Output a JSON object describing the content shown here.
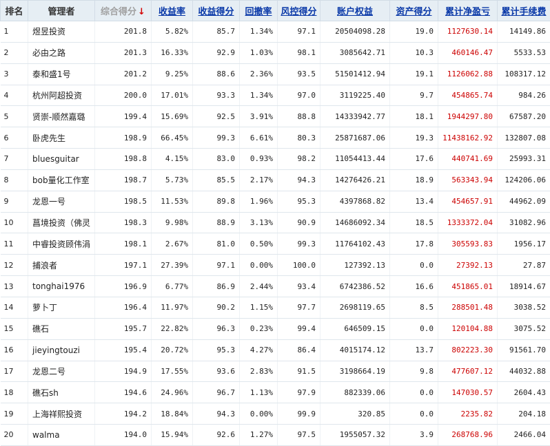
{
  "headers": {
    "rank": "排名",
    "manager": "管理者",
    "composite_score": "综合得分",
    "sort_arrow": "↓",
    "return_rate": "收益率",
    "return_score": "收益得分",
    "drawdown": "回撤率",
    "risk_score": "风控得分",
    "equity": "账户权益",
    "asset_score": "资产得分",
    "cum_pnl": "累计净盈亏",
    "cum_fee": "累计手续费"
  },
  "rows": [
    {
      "rank": "1",
      "name": "煜昱投资",
      "score": "201.8",
      "ret": "5.82%",
      "ret_score": "85.7",
      "dd": "1.34%",
      "risk": "97.1",
      "equity": "20504098.28",
      "asset": "19.0",
      "pnl": "1127630.14",
      "fee": "14149.86"
    },
    {
      "rank": "2",
      "name": "必由之路",
      "score": "201.3",
      "ret": "16.33%",
      "ret_score": "92.9",
      "dd": "1.03%",
      "risk": "98.1",
      "equity": "3085642.71",
      "asset": "10.3",
      "pnl": "460146.47",
      "fee": "5533.53"
    },
    {
      "rank": "3",
      "name": "泰和盛1号",
      "score": "201.2",
      "ret": "9.25%",
      "ret_score": "88.6",
      "dd": "2.36%",
      "risk": "93.5",
      "equity": "51501412.94",
      "asset": "19.1",
      "pnl": "1126062.88",
      "fee": "108317.12"
    },
    {
      "rank": "4",
      "name": "杭州阿超投资",
      "score": "200.0",
      "ret": "17.01%",
      "ret_score": "93.3",
      "dd": "1.34%",
      "risk": "97.0",
      "equity": "3119225.40",
      "asset": "9.7",
      "pnl": "454865.74",
      "fee": "984.26"
    },
    {
      "rank": "5",
      "name": "贤崇-顺然嘉璐",
      "score": "199.4",
      "ret": "15.69%",
      "ret_score": "92.5",
      "dd": "3.91%",
      "risk": "88.8",
      "equity": "14333942.77",
      "asset": "18.1",
      "pnl": "1944297.80",
      "fee": "67587.20"
    },
    {
      "rank": "6",
      "name": "卧虎先生",
      "score": "198.9",
      "ret": "66.45%",
      "ret_score": "99.3",
      "dd": "6.61%",
      "risk": "80.3",
      "equity": "25871687.06",
      "asset": "19.3",
      "pnl": "11438162.92",
      "fee": "132807.08"
    },
    {
      "rank": "7",
      "name": "bluesguitar",
      "score": "198.8",
      "ret": "4.15%",
      "ret_score": "83.0",
      "dd": "0.93%",
      "risk": "98.2",
      "equity": "11054413.44",
      "asset": "17.6",
      "pnl": "440741.69",
      "fee": "25993.31"
    },
    {
      "rank": "8",
      "name": "bob量化工作室",
      "score": "198.7",
      "ret": "5.73%",
      "ret_score": "85.5",
      "dd": "2.17%",
      "risk": "94.3",
      "equity": "14276426.21",
      "asset": "18.9",
      "pnl": "563343.94",
      "fee": "124206.06"
    },
    {
      "rank": "9",
      "name": "龙恩一号",
      "score": "198.5",
      "ret": "11.53%",
      "ret_score": "89.8",
      "dd": "1.96%",
      "risk": "95.3",
      "equity": "4397868.82",
      "asset": "13.4",
      "pnl": "454657.91",
      "fee": "44962.09"
    },
    {
      "rank": "10",
      "name": "菖境投资（佛灵",
      "score": "198.3",
      "ret": "9.98%",
      "ret_score": "88.9",
      "dd": "3.13%",
      "risk": "90.9",
      "equity": "14686092.34",
      "asset": "18.5",
      "pnl": "1333372.04",
      "fee": "31082.96"
    },
    {
      "rank": "11",
      "name": "中睿投资顾伟涓",
      "score": "198.1",
      "ret": "2.67%",
      "ret_score": "81.0",
      "dd": "0.50%",
      "risk": "99.3",
      "equity": "11764102.43",
      "asset": "17.8",
      "pnl": "305593.83",
      "fee": "1956.17"
    },
    {
      "rank": "12",
      "name": "捕浪者",
      "score": "197.1",
      "ret": "27.39%",
      "ret_score": "97.1",
      "dd": "0.00%",
      "risk": "100.0",
      "equity": "127392.13",
      "asset": "0.0",
      "pnl": "27392.13",
      "fee": "27.87"
    },
    {
      "rank": "13",
      "name": "tonghai1976",
      "score": "196.9",
      "ret": "6.77%",
      "ret_score": "86.9",
      "dd": "2.44%",
      "risk": "93.4",
      "equity": "6742386.52",
      "asset": "16.6",
      "pnl": "451865.01",
      "fee": "18914.67"
    },
    {
      "rank": "14",
      "name": "萝卜丁",
      "score": "196.4",
      "ret": "11.97%",
      "ret_score": "90.2",
      "dd": "1.15%",
      "risk": "97.7",
      "equity": "2698119.65",
      "asset": "8.5",
      "pnl": "288501.48",
      "fee": "3038.52"
    },
    {
      "rank": "15",
      "name": "礁石",
      "score": "195.7",
      "ret": "22.82%",
      "ret_score": "96.3",
      "dd": "0.23%",
      "risk": "99.4",
      "equity": "646509.15",
      "asset": "0.0",
      "pnl": "120104.88",
      "fee": "3075.52"
    },
    {
      "rank": "16",
      "name": "jieyingtouzi",
      "score": "195.4",
      "ret": "20.72%",
      "ret_score": "95.3",
      "dd": "4.27%",
      "risk": "86.4",
      "equity": "4015174.12",
      "asset": "13.7",
      "pnl": "802223.30",
      "fee": "91561.70"
    },
    {
      "rank": "17",
      "name": "龙恩二号",
      "score": "194.9",
      "ret": "17.55%",
      "ret_score": "93.6",
      "dd": "2.83%",
      "risk": "91.5",
      "equity": "3198664.19",
      "asset": "9.8",
      "pnl": "477607.12",
      "fee": "44032.88"
    },
    {
      "rank": "18",
      "name": "礁石sh",
      "score": "194.6",
      "ret": "24.96%",
      "ret_score": "96.7",
      "dd": "1.13%",
      "risk": "97.9",
      "equity": "882339.06",
      "asset": "0.0",
      "pnl": "147030.57",
      "fee": "2604.43"
    },
    {
      "rank": "19",
      "name": "上海祥熙投资",
      "score": "194.2",
      "ret": "18.84%",
      "ret_score": "94.3",
      "dd": "0.00%",
      "risk": "99.9",
      "equity": "320.85",
      "asset": "0.0",
      "pnl": "2235.82",
      "fee": "204.18"
    },
    {
      "rank": "20",
      "name": "walma",
      "score": "194.0",
      "ret": "15.94%",
      "ret_score": "92.6",
      "dd": "1.27%",
      "risk": "97.5",
      "equity": "1955057.32",
      "asset": "3.9",
      "pnl": "268768.96",
      "fee": "2466.04"
    }
  ]
}
